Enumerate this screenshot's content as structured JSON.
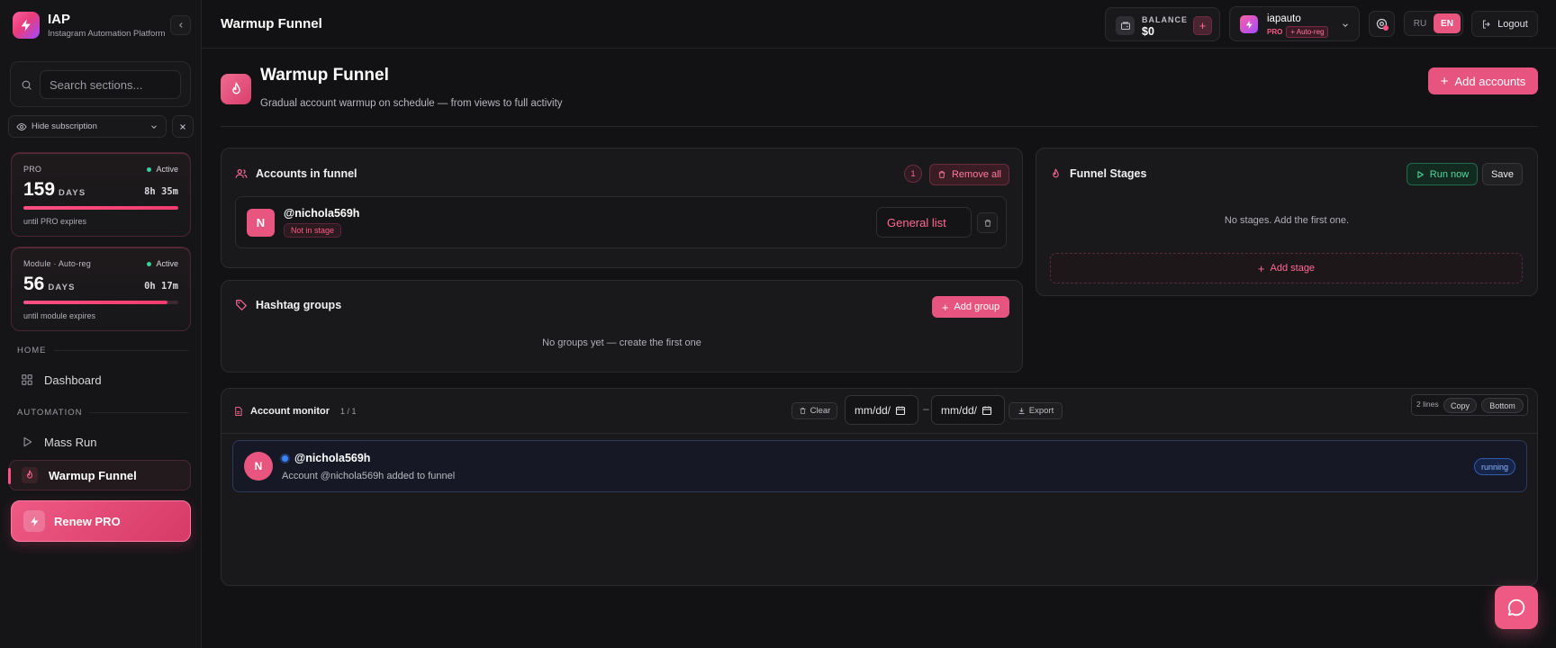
{
  "brand": {
    "title": "IAP",
    "subtitle": "Instagram Automation Platform"
  },
  "sidebar": {
    "search_placeholder": "Search sections...",
    "hide_subscription": "Hide subscription",
    "subscriptions": [
      {
        "kind": "PRO",
        "status": "Active",
        "days": "159",
        "days_label": "DAYS",
        "time": "8h 35m",
        "progress": 1.0,
        "until": "until PRO expires"
      },
      {
        "kind": "Module · Auto-reg",
        "status": "Active",
        "days": "56",
        "days_label": "DAYS",
        "time": "0h 17m",
        "progress": 0.93,
        "until": "until module expires"
      }
    ],
    "sections": [
      {
        "label": "HOME",
        "items": [
          {
            "label": "Dashboard",
            "icon": "grid-icon",
            "active": false
          }
        ]
      },
      {
        "label": "AUTOMATION",
        "items": [
          {
            "label": "Mass Run",
            "icon": "play-icon",
            "active": false
          },
          {
            "label": "Warmup Funnel",
            "icon": "flame-icon",
            "active": true
          }
        ]
      }
    ],
    "renew_label": "Renew PRO"
  },
  "header": {
    "title": "Warmup Funnel",
    "balance_label": "BALANCE",
    "balance_value": "$0",
    "username": "iapauto",
    "plan_tag": "PRO",
    "module_tag": "+ Auto-reg",
    "lang_options": [
      "RU",
      "EN"
    ],
    "lang_active": "EN",
    "logout_label": "Logout"
  },
  "page": {
    "title": "Warmup Funnel",
    "subtitle": "Gradual account warmup on schedule — from views to full activity",
    "add_accounts_label": "Add accounts"
  },
  "accounts_panel": {
    "title": "Accounts in funnel",
    "count": "1",
    "remove_all_label": "Remove all",
    "accounts": [
      {
        "initial": "N",
        "handle": "@nichola569h",
        "stage_tag": "Not in stage",
        "list": "General list"
      }
    ]
  },
  "hashtag_panel": {
    "title": "Hashtag groups",
    "add_group_label": "Add group",
    "empty_text": "No groups yet — create the first one"
  },
  "stages_panel": {
    "title": "Funnel Stages",
    "run_now_label": "Run now",
    "save_label": "Save",
    "empty_text": "No stages. Add the first one.",
    "add_stage_label": "Add stage"
  },
  "monitor": {
    "title": "Account monitor",
    "count": "1 / 1",
    "clear_label": "Clear",
    "date_from": "mm/dd/",
    "date_to": "mm/dd/",
    "date_sep": "–",
    "export_label": "Export",
    "lines_label": "2 lines",
    "copy_label": "Copy",
    "bottom_label": "Bottom",
    "entries": [
      {
        "initial": "N",
        "handle": "@nichola569h",
        "message": "Account @nichola569h added to funnel",
        "status": "running"
      }
    ]
  },
  "colors": {
    "accent": "#e8557e",
    "background": "#121214",
    "panel": "#19191c",
    "success": "#52d99a",
    "info": "#3b82f6"
  }
}
